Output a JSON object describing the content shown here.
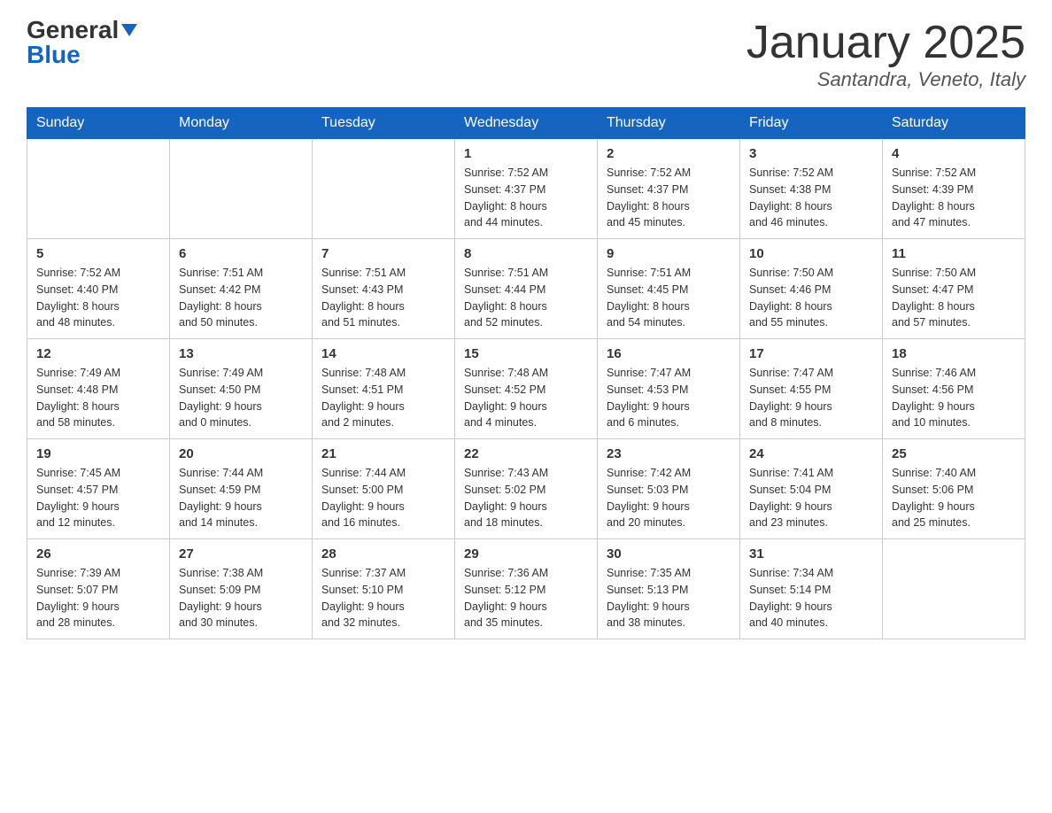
{
  "header": {
    "logo": {
      "general": "General",
      "blue": "Blue"
    },
    "title": "January 2025",
    "location": "Santandra, Veneto, Italy"
  },
  "days_of_week": [
    "Sunday",
    "Monday",
    "Tuesday",
    "Wednesday",
    "Thursday",
    "Friday",
    "Saturday"
  ],
  "weeks": [
    [
      null,
      null,
      null,
      {
        "day": 1,
        "sunrise": "7:52 AM",
        "sunset": "4:37 PM",
        "daylight": "8 hours and 44 minutes."
      },
      {
        "day": 2,
        "sunrise": "7:52 AM",
        "sunset": "4:37 PM",
        "daylight": "8 hours and 45 minutes."
      },
      {
        "day": 3,
        "sunrise": "7:52 AM",
        "sunset": "4:38 PM",
        "daylight": "8 hours and 46 minutes."
      },
      {
        "day": 4,
        "sunrise": "7:52 AM",
        "sunset": "4:39 PM",
        "daylight": "8 hours and 47 minutes."
      }
    ],
    [
      {
        "day": 5,
        "sunrise": "7:52 AM",
        "sunset": "4:40 PM",
        "daylight": "8 hours and 48 minutes."
      },
      {
        "day": 6,
        "sunrise": "7:51 AM",
        "sunset": "4:42 PM",
        "daylight": "8 hours and 50 minutes."
      },
      {
        "day": 7,
        "sunrise": "7:51 AM",
        "sunset": "4:43 PM",
        "daylight": "8 hours and 51 minutes."
      },
      {
        "day": 8,
        "sunrise": "7:51 AM",
        "sunset": "4:44 PM",
        "daylight": "8 hours and 52 minutes."
      },
      {
        "day": 9,
        "sunrise": "7:51 AM",
        "sunset": "4:45 PM",
        "daylight": "8 hours and 54 minutes."
      },
      {
        "day": 10,
        "sunrise": "7:50 AM",
        "sunset": "4:46 PM",
        "daylight": "8 hours and 55 minutes."
      },
      {
        "day": 11,
        "sunrise": "7:50 AM",
        "sunset": "4:47 PM",
        "daylight": "8 hours and 57 minutes."
      }
    ],
    [
      {
        "day": 12,
        "sunrise": "7:49 AM",
        "sunset": "4:48 PM",
        "daylight": "8 hours and 58 minutes."
      },
      {
        "day": 13,
        "sunrise": "7:49 AM",
        "sunset": "4:50 PM",
        "daylight": "9 hours and 0 minutes."
      },
      {
        "day": 14,
        "sunrise": "7:48 AM",
        "sunset": "4:51 PM",
        "daylight": "9 hours and 2 minutes."
      },
      {
        "day": 15,
        "sunrise": "7:48 AM",
        "sunset": "4:52 PM",
        "daylight": "9 hours and 4 minutes."
      },
      {
        "day": 16,
        "sunrise": "7:47 AM",
        "sunset": "4:53 PM",
        "daylight": "9 hours and 6 minutes."
      },
      {
        "day": 17,
        "sunrise": "7:47 AM",
        "sunset": "4:55 PM",
        "daylight": "9 hours and 8 minutes."
      },
      {
        "day": 18,
        "sunrise": "7:46 AM",
        "sunset": "4:56 PM",
        "daylight": "9 hours and 10 minutes."
      }
    ],
    [
      {
        "day": 19,
        "sunrise": "7:45 AM",
        "sunset": "4:57 PM",
        "daylight": "9 hours and 12 minutes."
      },
      {
        "day": 20,
        "sunrise": "7:44 AM",
        "sunset": "4:59 PM",
        "daylight": "9 hours and 14 minutes."
      },
      {
        "day": 21,
        "sunrise": "7:44 AM",
        "sunset": "5:00 PM",
        "daylight": "9 hours and 16 minutes."
      },
      {
        "day": 22,
        "sunrise": "7:43 AM",
        "sunset": "5:02 PM",
        "daylight": "9 hours and 18 minutes."
      },
      {
        "day": 23,
        "sunrise": "7:42 AM",
        "sunset": "5:03 PM",
        "daylight": "9 hours and 20 minutes."
      },
      {
        "day": 24,
        "sunrise": "7:41 AM",
        "sunset": "5:04 PM",
        "daylight": "9 hours and 23 minutes."
      },
      {
        "day": 25,
        "sunrise": "7:40 AM",
        "sunset": "5:06 PM",
        "daylight": "9 hours and 25 minutes."
      }
    ],
    [
      {
        "day": 26,
        "sunrise": "7:39 AM",
        "sunset": "5:07 PM",
        "daylight": "9 hours and 28 minutes."
      },
      {
        "day": 27,
        "sunrise": "7:38 AM",
        "sunset": "5:09 PM",
        "daylight": "9 hours and 30 minutes."
      },
      {
        "day": 28,
        "sunrise": "7:37 AM",
        "sunset": "5:10 PM",
        "daylight": "9 hours and 32 minutes."
      },
      {
        "day": 29,
        "sunrise": "7:36 AM",
        "sunset": "5:12 PM",
        "daylight": "9 hours and 35 minutes."
      },
      {
        "day": 30,
        "sunrise": "7:35 AM",
        "sunset": "5:13 PM",
        "daylight": "9 hours and 38 minutes."
      },
      {
        "day": 31,
        "sunrise": "7:34 AM",
        "sunset": "5:14 PM",
        "daylight": "9 hours and 40 minutes."
      },
      null
    ]
  ],
  "labels": {
    "sunrise": "Sunrise:",
    "sunset": "Sunset:",
    "daylight": "Daylight:"
  }
}
